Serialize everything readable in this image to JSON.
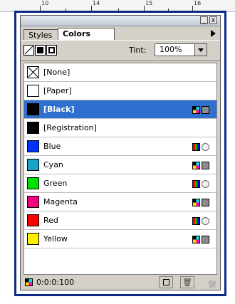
{
  "ruler": {
    "labels": [
      "10",
      "14",
      "15",
      "16"
    ]
  },
  "titlebar": {
    "minimize": "_",
    "close": "x"
  },
  "tabs": [
    {
      "label": "Styles",
      "active": false
    },
    {
      "label": "Colors",
      "active": true
    }
  ],
  "toolbar": {
    "icons": [
      "none-swatch-tool-icon",
      "fill-tool-icon",
      "stroke-tool-icon"
    ],
    "tint_label": "Tint:",
    "tint_value": "100%"
  },
  "swatches": [
    {
      "label": "[None]",
      "color": "none",
      "selected": false,
      "model": "",
      "type": ""
    },
    {
      "label": "[Paper]",
      "color": "#ffffff",
      "selected": false,
      "model": "",
      "type": ""
    },
    {
      "label": "[Black]",
      "color": "#000000",
      "selected": true,
      "model": "cmyk",
      "type": "process"
    },
    {
      "label": "[Registration]",
      "color": "#000000",
      "selected": false,
      "model": "",
      "type": ""
    },
    {
      "label": "Blue",
      "color": "#0033ff",
      "selected": false,
      "model": "rgb",
      "type": "spot"
    },
    {
      "label": "Cyan",
      "color": "#1aa3c8",
      "selected": false,
      "model": "cmyk",
      "type": "process"
    },
    {
      "label": "Green",
      "color": "#00e000",
      "selected": false,
      "model": "rgb",
      "type": "spot"
    },
    {
      "label": "Magenta",
      "color": "#f0047f",
      "selected": false,
      "model": "cmyk",
      "type": "process"
    },
    {
      "label": "Red",
      "color": "#ff0000",
      "selected": false,
      "model": "rgb",
      "type": "spot"
    },
    {
      "label": "Yellow",
      "color": "#ffee00",
      "selected": false,
      "model": "cmyk",
      "type": "process"
    }
  ],
  "footer": {
    "value": "0:0:0:100",
    "new_icon": "new-swatch-icon",
    "delete_icon": "trash-icon"
  },
  "colors": {
    "selection": "#2f6fd0",
    "frame": "#0a2a8a",
    "panel": "#d4d0c8"
  }
}
